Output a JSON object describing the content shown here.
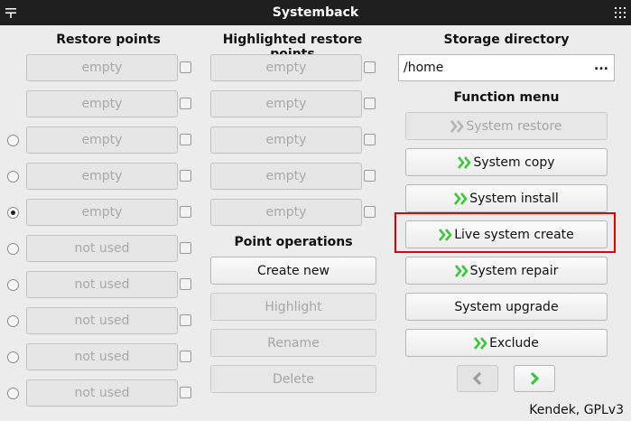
{
  "window": {
    "title": "Systemback"
  },
  "headers": {
    "restore_points": "Restore points",
    "highlighted": "Highlighted restore points",
    "storage": "Storage directory",
    "function_menu": "Function menu",
    "point_operations": "Point operations"
  },
  "restore_points": [
    "empty",
    "empty",
    "empty",
    "empty",
    "empty",
    "not used",
    "not used",
    "not used",
    "not used",
    "not used"
  ],
  "highlighted_points": [
    "empty",
    "empty",
    "empty",
    "empty",
    "empty"
  ],
  "storage": {
    "path": "/home",
    "browse_label": "..."
  },
  "point_operations": {
    "create_new": "Create new",
    "highlight": "Highlight",
    "rename": "Rename",
    "delete": "Delete"
  },
  "function_menu": {
    "system_restore": "System restore",
    "system_copy": "System copy",
    "system_install": "System install",
    "live_system_create": "Live system create",
    "system_repair": "System repair",
    "system_upgrade": "System upgrade",
    "exclude": "Exclude"
  },
  "footer": {
    "credit": "Kendek, GPLv3"
  },
  "colors": {
    "accent_green": "#3cc63c",
    "disabled_grey": "#a6a6a6",
    "highlight_red": "#e00000"
  }
}
